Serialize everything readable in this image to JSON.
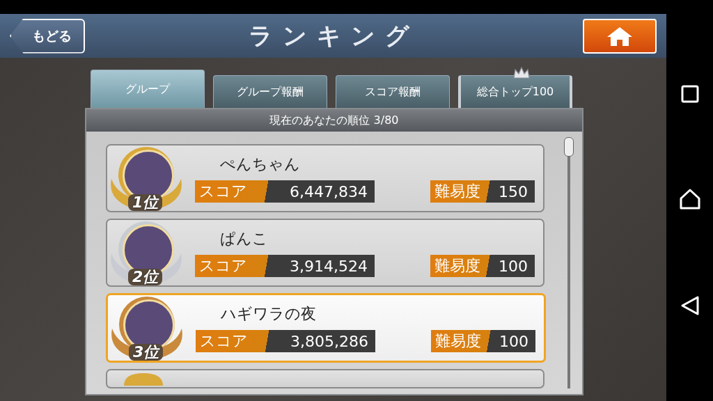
{
  "header": {
    "back_button": "もどる",
    "title": "ランキング"
  },
  "tabs": [
    {
      "label": "グループ",
      "selected": true,
      "kind": "plain"
    },
    {
      "label": "グループ報酬",
      "selected": false,
      "kind": "plain"
    },
    {
      "label": "スコア報酬",
      "selected": false,
      "kind": "plain"
    },
    {
      "label": "総合トップ100",
      "selected": false,
      "kind": "crown"
    }
  ],
  "panel": {
    "heading": "現在のあなたの順位 3/80"
  },
  "rows": [
    {
      "kind": "full",
      "rank": "1位",
      "name": "ぺんちゃん",
      "score_label": "スコア",
      "score": "6,447,834",
      "difficulty_label": "難易度",
      "difficulty": "150",
      "color": "#d9a93a",
      "selected": false
    },
    {
      "kind": "full",
      "rank": "2位",
      "name": "ぱんこ",
      "score_label": "スコア",
      "score": "3,914,524",
      "difficulty_label": "難易度",
      "difficulty": "100",
      "color": "#c8ccd2",
      "selected": false
    },
    {
      "kind": "full",
      "rank": "3位",
      "name": "ハギワラの夜",
      "score_label": "スコア",
      "score": "3,805,286",
      "difficulty_label": "難易度",
      "difficulty": "100",
      "color": "#c98a3c",
      "selected": true
    },
    {
      "kind": "partial",
      "color": "#d9a93a",
      "selected": false
    }
  ]
}
